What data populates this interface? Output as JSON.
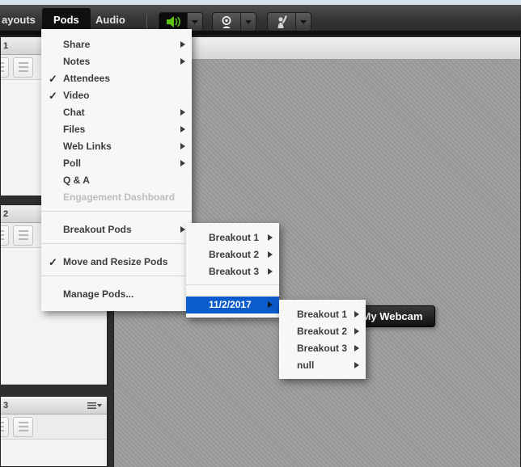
{
  "top_bar": {
    "menu_items": [
      {
        "label": "ayouts"
      },
      {
        "label": "Pods",
        "active": true
      },
      {
        "label": "Audio"
      }
    ],
    "icons": {
      "speaker": "speaker-icon (green, active)",
      "webcam": "webcam-icon",
      "raise_hand": "raise-hand-icon",
      "dropdown": "caret-down-icon"
    },
    "accent_green": "#5cc214"
  },
  "pods_menu": {
    "items": [
      {
        "label": "Share",
        "has_submenu": true
      },
      {
        "label": "Notes",
        "has_submenu": true
      },
      {
        "label": "Attendees",
        "checked": true
      },
      {
        "label": "Video",
        "checked": true
      },
      {
        "label": "Chat",
        "has_submenu": true
      },
      {
        "label": "Files",
        "has_submenu": true
      },
      {
        "label": "Web Links",
        "has_submenu": true
      },
      {
        "label": "Poll",
        "has_submenu": true
      },
      {
        "label": "Q & A"
      },
      {
        "label": "Engagement Dashboard",
        "disabled": true
      },
      {
        "label": "Breakout Pods",
        "has_submenu": true,
        "expanded": true
      },
      {
        "label": "Move and Resize Pods",
        "checked": true
      },
      {
        "label": "Manage Pods..."
      }
    ],
    "glyphs": {
      "check": "✓"
    }
  },
  "breakout_submenu": {
    "items": [
      {
        "label": "Breakout 1",
        "has_submenu": true
      },
      {
        "label": "Breakout 2",
        "has_submenu": true
      },
      {
        "label": "Breakout 3",
        "has_submenu": true
      },
      {
        "label": "11/2/2017",
        "has_submenu": true,
        "highlighted": true
      }
    ],
    "highlight_blue": "#0b5bca"
  },
  "date_submenu": {
    "items": [
      {
        "label": "Breakout 1",
        "has_submenu": true
      },
      {
        "label": "Breakout 2",
        "has_submenu": true
      },
      {
        "label": "Breakout 3",
        "has_submenu": true
      },
      {
        "label": "null",
        "has_submenu": true
      }
    ]
  },
  "side_pods": {
    "titles": [
      "1",
      "2",
      "3"
    ]
  },
  "main_pod": {
    "webcam_overlay_label": "My Webcam"
  }
}
